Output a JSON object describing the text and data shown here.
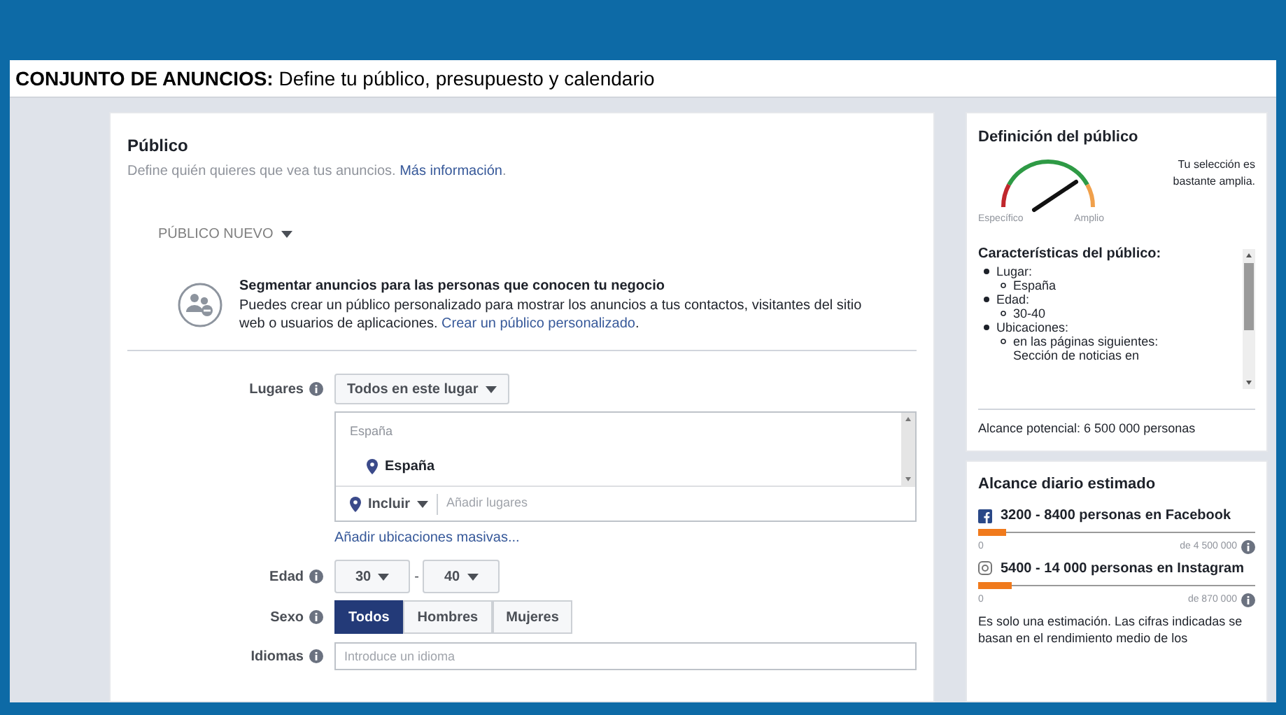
{
  "header": {
    "title": "**CONJUNTO DE ANUNCIOS:** Define tu público, presupuesto y calendario"
  },
  "audience": {
    "title": "Público",
    "description": "Define quién quieres que vea tus anuncios.",
    "link": "Más información",
    "suffix": "."
  },
  "new_audience": {
    "label": "PÚBLICO NUEVO"
  },
  "custom_audience": {
    "title": "Segmentar anuncios para las personas que conocen tu negocio",
    "text": "Puedes crear un público personalizado para mostrar los anuncios a tus contactos, visitantes del sitio web o usuarios de aplicaciones.",
    "link": "Crear un público personalizado",
    "suffix": "."
  },
  "locations": {
    "label": "Lugares",
    "dropdown": "Todos en este lugar",
    "group": "España",
    "items": [
      {
        "name": "España"
      }
    ],
    "include": "Incluir",
    "placeholder": "Añadir lugares",
    "bulk_link": "Añadir ubicaciones masivas..."
  },
  "age": {
    "label": "Edad",
    "min": "30",
    "separator": "-",
    "max": "40"
  },
  "gender": {
    "label": "Sexo",
    "options": [
      {
        "label": "Todos",
        "selected": true
      },
      {
        "label": "Hombres",
        "selected": false
      },
      {
        "label": "Mujeres",
        "selected": false
      }
    ]
  },
  "languages": {
    "label": "Idiomas",
    "placeholder": "Introduce un idioma"
  },
  "definition": {
    "title": "Definición del público",
    "gauge": {
      "left_label": "Específico",
      "right_label": "Amplio"
    },
    "note": "Tu selección es bastante amplia."
  },
  "characteristics": {
    "title": "Características del público:",
    "items": [
      {
        "label": "Lugar:",
        "children": [
          {
            "label": "España"
          }
        ]
      },
      {
        "label": "Edad:",
        "children": [
          {
            "label": "30-40"
          }
        ]
      },
      {
        "label": "Ubicaciones:",
        "children": [
          {
            "label": "en las páginas siguientes: Sección de noticias en"
          }
        ]
      }
    ]
  },
  "potential_reach": "Alcance potencial: 6 500 000 personas",
  "daily_reach": {
    "title": "Alcance diario estimado",
    "platforms": [
      {
        "kind": "facebook",
        "label": "3200 - 8400 personas en Facebook",
        "level": 0.1,
        "min": "0",
        "max": "de 4 500 000"
      },
      {
        "kind": "instagram",
        "label": "5400 - 14 000 personas en Instagram",
        "level": 0.12,
        "min": "0",
        "max": "de 870 000"
      }
    ],
    "note": "Es solo una estimación. Las cifras indicadas se basan en el rendimiento medio de los"
  }
}
